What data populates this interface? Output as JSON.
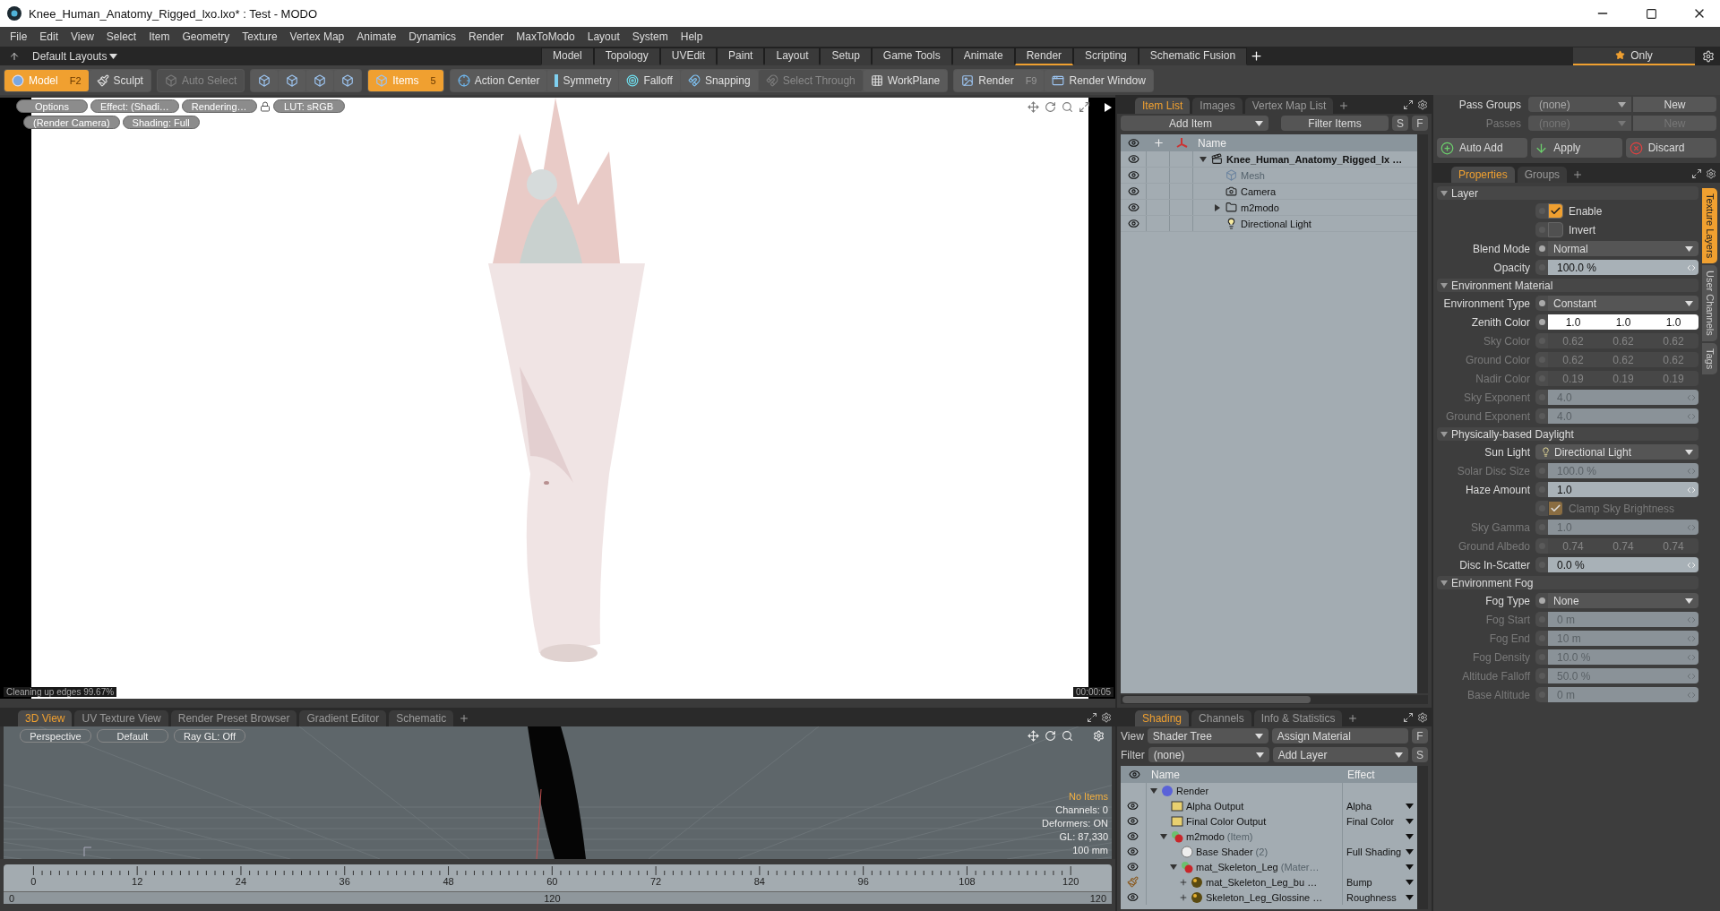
{
  "window": {
    "title": "Knee_Human_Anatomy_Rigged_lxo.lxo* : Test - MODO"
  },
  "menu": [
    "File",
    "Edit",
    "View",
    "Select",
    "Item",
    "Geometry",
    "Texture",
    "Vertex Map",
    "Animate",
    "Dynamics",
    "Render",
    "MaxToModo",
    "Layout",
    "System",
    "Help"
  ],
  "layouts": {
    "label": "Default Layouts",
    "tabs": [
      {
        "label": "Model",
        "selected": false
      },
      {
        "label": "Topology",
        "selected": false
      },
      {
        "label": "UVEdit",
        "selected": false
      },
      {
        "label": "Paint",
        "selected": false
      },
      {
        "label": "Layout",
        "selected": false
      },
      {
        "label": "Setup",
        "selected": false
      },
      {
        "label": "Game Tools",
        "selected": false
      },
      {
        "label": "Animate",
        "selected": false
      },
      {
        "label": "Render",
        "selected": true
      },
      {
        "label": "Scripting",
        "selected": false
      },
      {
        "label": "Schematic Fusion",
        "selected": false
      }
    ],
    "only": "Only"
  },
  "toolbar": [
    [
      {
        "kind": "sphere",
        "label": "Model",
        "shortcut": "F2",
        "selected": true,
        "disabled": false
      },
      {
        "kind": "brush",
        "label": "Sculpt",
        "selected": false,
        "disabled": false
      }
    ],
    [
      {
        "kind": "cube",
        "label": "Auto Select",
        "selected": false,
        "disabled": true
      }
    ],
    [
      {
        "kind": "cube",
        "selected": false,
        "disabled": false
      },
      {
        "kind": "cube",
        "selected": false,
        "disabled": false
      },
      {
        "kind": "cube",
        "selected": false,
        "disabled": false
      },
      {
        "kind": "cube",
        "selected": false,
        "disabled": false
      }
    ],
    [
      {
        "kind": "cube",
        "label": "Items",
        "shortcut": "5",
        "selected": true,
        "disabled": false
      }
    ],
    [
      {
        "kind": "crosshair",
        "label": "Action Center",
        "selected": false,
        "disabled": false
      },
      {
        "kind": "bar",
        "label": "Symmetry",
        "selected": false,
        "disabled": false
      },
      {
        "kind": "target",
        "label": "Falloff",
        "selected": false,
        "disabled": false
      },
      {
        "kind": "snap",
        "label": "Snapping",
        "selected": false,
        "disabled": false
      },
      {
        "kind": "snap",
        "label": "Select Through",
        "selected": false,
        "disabled": true
      },
      {
        "kind": "grid",
        "label": "WorkPlane",
        "selected": false,
        "disabled": false
      }
    ],
    [
      {
        "kind": "render",
        "label": "Render",
        "shortcut": "F9",
        "selected": false,
        "disabled": false
      },
      {
        "kind": "window",
        "label": "Render Window",
        "selected": false,
        "disabled": false
      }
    ]
  ],
  "render_view": {
    "overlay_top": [
      {
        "kind": "button",
        "label": "Options"
      },
      {
        "kind": "button",
        "label": "Effect: (Shadi…"
      },
      {
        "kind": "button",
        "label": "Rendering…"
      },
      {
        "kind": "lock"
      },
      {
        "kind": "button",
        "label": "LUT: sRGB"
      }
    ],
    "overlay_second": [
      {
        "kind": "button",
        "label": "(Render Camera)"
      },
      {
        "kind": "button",
        "label": "Shading: Full"
      }
    ],
    "status": "Cleaning up edges 99.67%",
    "time": "00:00:05"
  },
  "item_list": {
    "tabs": [
      {
        "label": "Item List",
        "selected": true
      },
      {
        "label": "Images",
        "selected": false
      },
      {
        "label": "Vertex Map List",
        "selected": false
      }
    ],
    "add_item": "Add Item",
    "filter": "Filter Items",
    "buttons": [
      "S",
      "F"
    ],
    "column": "Name",
    "tree": [
      {
        "name": "Knee_Human_Anatomy_Rigged_lx …",
        "kind": "scene",
        "disabled": false,
        "expanded": true,
        "children": [
          {
            "name": "Mesh",
            "kind": "mesh",
            "disabled": true
          },
          {
            "name": "Camera",
            "kind": "camera",
            "disabled": false
          },
          {
            "name": "m2modo",
            "kind": "group",
            "disabled": false,
            "expanded": false
          },
          {
            "name": "Directional Light",
            "kind": "light",
            "disabled": false
          }
        ]
      }
    ]
  },
  "passes": [
    {
      "label": "Pass Groups",
      "value": "(none)",
      "button": "New",
      "disabled": false
    },
    {
      "label": "Passes",
      "value": "(none)",
      "button": "New",
      "disabled": true
    }
  ],
  "actions": [
    {
      "kind": "add",
      "label": "Auto Add"
    },
    {
      "kind": "apply",
      "label": "Apply"
    },
    {
      "kind": "discard",
      "label": "Discard"
    }
  ],
  "properties": {
    "tabs": [
      {
        "label": "Properties",
        "selected": true
      },
      {
        "label": "Groups",
        "selected": false
      }
    ],
    "side_tabs": [
      {
        "label": "Texture Layers",
        "selected": true
      },
      {
        "label": "User Channels",
        "selected": false
      },
      {
        "label": "Tags",
        "selected": false
      }
    ],
    "rows": [
      {
        "kind": "section",
        "label": "Layer"
      },
      {
        "kind": "check",
        "label": "Enable",
        "checked": true,
        "disabled": false
      },
      {
        "kind": "check",
        "label": "Invert",
        "checked": false,
        "disabled": false
      },
      {
        "kind": "dropdown",
        "label": "Blend Mode",
        "value": "Normal",
        "disabled": false
      },
      {
        "kind": "slider",
        "label": "Opacity",
        "value": "100.0 %",
        "disabled": false
      },
      {
        "kind": "section",
        "label": "Environment Material"
      },
      {
        "kind": "dropdown",
        "label": "Environment Type",
        "value": "Constant",
        "disabled": false
      },
      {
        "kind": "color",
        "label": "Zenith Color",
        "values": [
          "1.0",
          "1.0",
          "1.0"
        ],
        "disabled": false
      },
      {
        "kind": "color",
        "label": "Sky Color",
        "values": [
          "0.62",
          "0.62",
          "0.62"
        ],
        "disabled": true
      },
      {
        "kind": "color",
        "label": "Ground Color",
        "values": [
          "0.62",
          "0.62",
          "0.62"
        ],
        "disabled": true
      },
      {
        "kind": "color",
        "label": "Nadir Color",
        "values": [
          "0.19",
          "0.19",
          "0.19"
        ],
        "disabled": true
      },
      {
        "kind": "slider",
        "label": "Sky Exponent",
        "value": "4.0",
        "disabled": true
      },
      {
        "kind": "slider",
        "label": "Ground Exponent",
        "value": "4.0",
        "disabled": true
      },
      {
        "kind": "section",
        "label": "Physically-based Daylight"
      },
      {
        "kind": "item",
        "label": "Sun Light",
        "value": "Directional Light",
        "disabled": false
      },
      {
        "kind": "slider",
        "label": "Solar Disc Size",
        "value": "100.0 %",
        "disabled": true
      },
      {
        "kind": "slider",
        "label": "Haze Amount",
        "value": "1.0",
        "disabled": false
      },
      {
        "kind": "check",
        "label": "Clamp Sky Brightness",
        "checked": true,
        "disabled": true
      },
      {
        "kind": "slider",
        "label": "Sky Gamma",
        "value": "1.0",
        "disabled": true
      },
      {
        "kind": "color",
        "label": "Ground Albedo",
        "values": [
          "0.74",
          "0.74",
          "0.74"
        ],
        "disabled": true
      },
      {
        "kind": "slider",
        "label": "Disc In-Scatter",
        "value": "0.0 %",
        "disabled": false
      },
      {
        "kind": "section",
        "label": "Environment Fog"
      },
      {
        "kind": "dropdown",
        "label": "Fog Type",
        "value": "None",
        "disabled": false
      },
      {
        "kind": "slider",
        "label": "Fog Start",
        "value": "0 m",
        "disabled": true
      },
      {
        "kind": "slider",
        "label": "Fog End",
        "value": "10 m",
        "disabled": true
      },
      {
        "kind": "slider",
        "label": "Fog Density",
        "value": "10.0 %",
        "disabled": true
      },
      {
        "kind": "slider",
        "label": "Altitude Falloff",
        "value": "50.0 %",
        "disabled": true
      },
      {
        "kind": "slider",
        "label": "Base Altitude",
        "value": "0 m",
        "disabled": true
      }
    ]
  },
  "view3d": {
    "tabs": [
      {
        "label": "3D View",
        "selected": true
      },
      {
        "label": "UV Texture View",
        "selected": false
      },
      {
        "label": "Render Preset Browser",
        "selected": false
      },
      {
        "label": "Gradient Editor",
        "selected": false
      },
      {
        "label": "Schematic",
        "selected": false
      }
    ],
    "buttons": [
      "Perspective",
      "Default",
      "Ray GL: Off"
    ],
    "info": [
      {
        "text": "No Items",
        "kind": "warning"
      },
      {
        "text": "Channels: 0",
        "kind": "plain"
      },
      {
        "text": "Deformers: ON",
        "kind": "plain"
      },
      {
        "text": "GL: 87,330",
        "kind": "plain"
      },
      {
        "text": "100 mm",
        "kind": "plain"
      }
    ]
  },
  "timeline": {
    "ticks": [
      "0",
      "12",
      "24",
      "36",
      "48",
      "60",
      "72",
      "84",
      "96",
      "108",
      "120"
    ],
    "range_start": "0",
    "range_mid": "120",
    "range_end": "120"
  },
  "shading": {
    "tabs": [
      {
        "label": "Shading",
        "selected": true
      },
      {
        "label": "Channels",
        "selected": false
      },
      {
        "label": "Info & Statistics",
        "selected": false
      }
    ],
    "view_label": "View",
    "view": "Shader Tree",
    "assign": "Assign Material",
    "filter_label": "Filter",
    "filter": "(none)",
    "add_layer": "Add Layer",
    "buttons": [
      "F",
      "S"
    ],
    "columns": [
      "Name",
      "Effect"
    ],
    "tree": [
      {
        "name": "Render",
        "kind": "render",
        "visible": false,
        "expanded": true,
        "children": [
          {
            "name": "Alpha Output",
            "kind": "output",
            "effect": "Alpha",
            "visible": true,
            "edit": false
          },
          {
            "name": "Final Color Output",
            "kind": "output",
            "effect": "Final Color",
            "visible": true,
            "edit": false
          },
          {
            "name": "m2modo",
            "note": "(Item)",
            "kind": "material",
            "visible": true,
            "edit": false,
            "expanded": true,
            "children": [
              {
                "name": "Base Shader",
                "note": "(2)",
                "kind": "shader",
                "effect": "Full Shading",
                "visible": true,
                "edit": false
              },
              {
                "name": "mat_Skeleton_Leg",
                "note": "(Mater…",
                "kind": "material",
                "visible": true,
                "edit": false,
                "expanded": true,
                "children": [
                  {
                    "name": "mat_Skeleton_Leg_bu …",
                    "kind": "texture",
                    "effect": "Bump",
                    "visible": true,
                    "edit": true,
                    "expanded": false
                  },
                  {
                    "name": "Skeleton_Leg_Glossine …",
                    "kind": "texture",
                    "effect": "Roughness",
                    "visible": true,
                    "edit": false,
                    "expanded": false
                  }
                ]
              }
            ]
          }
        ]
      }
    ]
  }
}
